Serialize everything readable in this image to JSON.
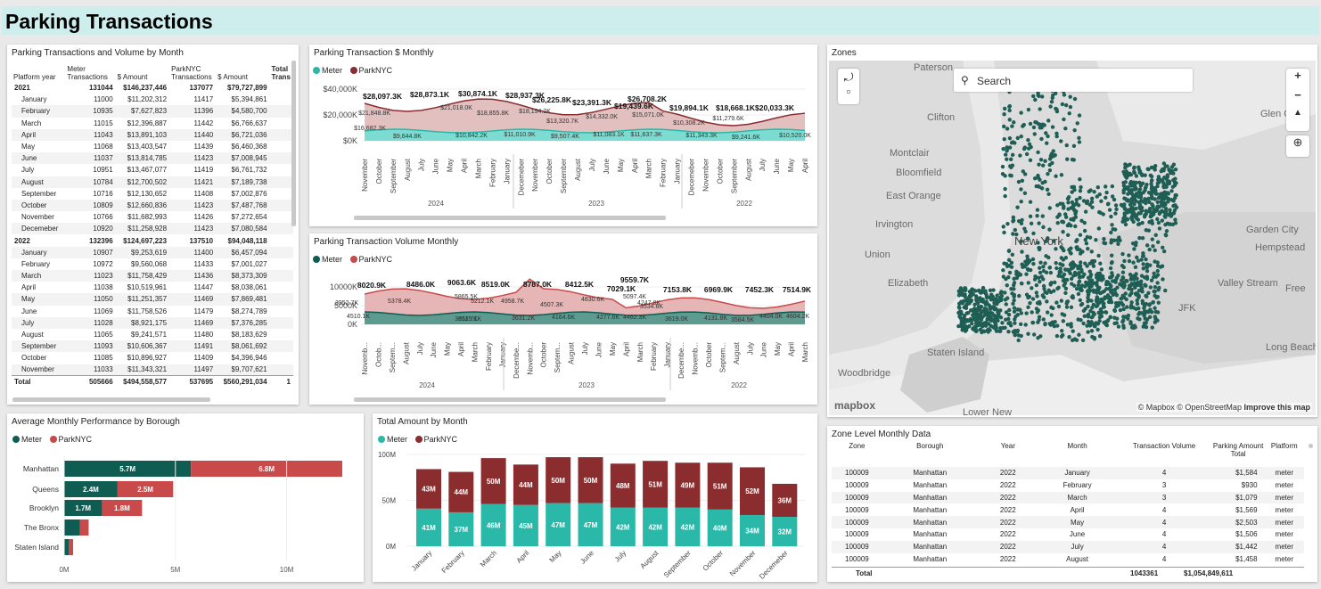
{
  "page": {
    "title": "Parking Transactions"
  },
  "colors": {
    "meter": "#2ab9a8",
    "parknyc": "#8b2c2e",
    "meter_dark": "#0f5d52",
    "parknyc_light": "#c94a4a"
  },
  "matrix": {
    "title": "Parking Transactions and Volume by Month",
    "headers": {
      "year": "Platform year",
      "meter_tx": "Meter Transactions",
      "meter_amt": "$ Amount",
      "park_tx": "ParkNYC Transactions",
      "park_amt": "$ Amount",
      "total": "Total Trans"
    },
    "rows": [
      {
        "k": "yr",
        "c": [
          "2021",
          "131044",
          "$146,237,446",
          "137077",
          "$79,727,899",
          ""
        ]
      },
      {
        "k": "mo",
        "c": [
          "January",
          "11000",
          "$11,202,312",
          "11417",
          "$5,394,861",
          ""
        ]
      },
      {
        "k": "mo",
        "c": [
          "February",
          "10935",
          "$7,627,823",
          "11396",
          "$4,580,700",
          ""
        ]
      },
      {
        "k": "mo",
        "c": [
          "March",
          "11015",
          "$12,396,887",
          "11442",
          "$6,766,637",
          ""
        ]
      },
      {
        "k": "mo",
        "c": [
          "April",
          "11043",
          "$13,891,103",
          "11440",
          "$6,721,036",
          ""
        ]
      },
      {
        "k": "mo",
        "c": [
          "May",
          "11068",
          "$13,403,547",
          "11439",
          "$6,460,368",
          ""
        ]
      },
      {
        "k": "mo",
        "c": [
          "June",
          "11037",
          "$13,814,785",
          "11423",
          "$7,008,945",
          ""
        ]
      },
      {
        "k": "mo",
        "c": [
          "July",
          "10951",
          "$13,467,077",
          "11419",
          "$6,761,732",
          ""
        ]
      },
      {
        "k": "mo",
        "c": [
          "August",
          "10784",
          "$12,700,502",
          "11421",
          "$7,189,738",
          ""
        ]
      },
      {
        "k": "mo",
        "c": [
          "September",
          "10716",
          "$12,130,652",
          "11408",
          "$7,002,876",
          ""
        ]
      },
      {
        "k": "mo",
        "c": [
          "October",
          "10809",
          "$12,660,836",
          "11423",
          "$7,487,768",
          ""
        ]
      },
      {
        "k": "mo",
        "c": [
          "November",
          "10766",
          "$11,682,993",
          "11426",
          "$7,272,654",
          ""
        ]
      },
      {
        "k": "mo",
        "c": [
          "Decemeber",
          "10920",
          "$11,258,928",
          "11423",
          "$7,080,584",
          ""
        ]
      },
      {
        "k": "yr",
        "c": [
          "2022",
          "132396",
          "$124,697,223",
          "137510",
          "$94,048,118",
          ""
        ]
      },
      {
        "k": "mo",
        "c": [
          "January",
          "10907",
          "$9,253,619",
          "11400",
          "$6,457,094",
          ""
        ]
      },
      {
        "k": "mo",
        "c": [
          "February",
          "10972",
          "$9,560,068",
          "11433",
          "$7,001,027",
          ""
        ]
      },
      {
        "k": "mo",
        "c": [
          "March",
          "11023",
          "$11,758,429",
          "11436",
          "$8,373,309",
          ""
        ]
      },
      {
        "k": "mo",
        "c": [
          "April",
          "11038",
          "$10,519,961",
          "11447",
          "$8,038,061",
          ""
        ]
      },
      {
        "k": "mo",
        "c": [
          "May",
          "11050",
          "$11,251,357",
          "11469",
          "$7,869,481",
          ""
        ]
      },
      {
        "k": "mo",
        "c": [
          "June",
          "11069",
          "$11,758,526",
          "11479",
          "$8,274,789",
          ""
        ]
      },
      {
        "k": "mo",
        "c": [
          "July",
          "11028",
          "$8,921,175",
          "11469",
          "$7,376,285",
          ""
        ]
      },
      {
        "k": "mo",
        "c": [
          "August",
          "11065",
          "$9,241,571",
          "11480",
          "$8,183,629",
          ""
        ]
      },
      {
        "k": "mo",
        "c": [
          "September",
          "11093",
          "$10,606,367",
          "11491",
          "$8,061,692",
          ""
        ]
      },
      {
        "k": "mo",
        "c": [
          "October",
          "11085",
          "$10,896,927",
          "11409",
          "$4,396,946",
          ""
        ]
      },
      {
        "k": "mo",
        "c": [
          "November",
          "11033",
          "$11,343,321",
          "11497",
          "$9,707,621",
          ""
        ]
      },
      {
        "k": "tot",
        "c": [
          "Total",
          "505666",
          "$494,558,577",
          "537695",
          "$560,291,034",
          "1"
        ]
      }
    ]
  },
  "amount_chart": {
    "title": "Parking Transaction $ Monthly",
    "legend": [
      "Meter",
      "ParkNYC"
    ],
    "y_ticks": [
      "$40,000K",
      "$20,000K",
      "$0K"
    ],
    "months": [
      "November",
      "October",
      "September",
      "August",
      "July",
      "June",
      "May",
      "April",
      "March",
      "February",
      "January",
      "Decemeber",
      "November",
      "October",
      "September",
      "August",
      "July",
      "June",
      "May",
      "April",
      "March",
      "February",
      "January",
      "Decemeber",
      "November",
      "October",
      "September",
      "August",
      "July",
      "June",
      "May",
      "April"
    ],
    "years": [
      "2024",
      "2023",
      "2022"
    ],
    "top_labels": [
      "$28,097.3K",
      "$28,873.1K",
      "$30,874.1K",
      "$28,937.3K",
      "$26,225.8K",
      "$23,391.3K",
      "$26,708.2K",
      "$19,439.6K",
      "$19,894.1K",
      "$18,668.1K",
      "$20,033.3K"
    ],
    "park_labels": [
      "$16,682.3K",
      "$21,848.8K",
      "$21,018.0K",
      "$18,855.8K",
      "$18,194.2K",
      "$13,320.7K",
      "$14,332.0K",
      "$15,071.0K",
      "$10,308.2K",
      "$11,279.6K"
    ],
    "meter_labels": [
      "$9,644.8K",
      "$10,842.2K",
      "$11,010.9K",
      "$9,507.4K",
      "$11,083.1K",
      "$11,637.3K",
      "$11,343.3K",
      "$9,241.6K",
      "$10,520.0K"
    ]
  },
  "volume_chart": {
    "title": "Parking Transaction Volume Monthly",
    "legend": [
      "Meter",
      "ParkNYC"
    ],
    "y_ticks": [
      "10000K",
      "5000K",
      "0K"
    ],
    "months": [
      "Novemb...",
      "Octob...",
      "Septem...",
      "August",
      "July",
      "June",
      "May",
      "April",
      "March",
      "February",
      "January",
      "Decembe...",
      "Novemb...",
      "October",
      "Septem...",
      "August",
      "July",
      "June",
      "May",
      "April",
      "March",
      "February",
      "January",
      "Decembe...",
      "Novemb...",
      "October",
      "Septem...",
      "August",
      "July",
      "June",
      "May",
      "April",
      "March"
    ],
    "years": [
      "2024",
      "2023",
      "2022"
    ],
    "top_labels": [
      "8020.9K",
      "8486.0K",
      "9063.6K",
      "8519.0K",
      "8787.0K",
      "8412.5K",
      "9559.7K",
      "7029.1K",
      "7153.8K",
      "6969.9K",
      "7452.3K",
      "7514.9K"
    ],
    "park_labels": [
      "3952.7K",
      "5378.4K",
      "5865.5K",
      "5212.1K",
      "4958.7K",
      "4507.3K",
      "4830.6K",
      "5097.4K",
      "4247.8K",
      "3534.8K"
    ],
    "meter_labels": [
      "4510.1K",
      "3611.7K",
      "3535.1K",
      "3631.2K",
      "4164.6K",
      "4277.6K",
      "4462.3K",
      "3619.0K",
      "4131.8K",
      "3584.5K",
      "4404.0K",
      "4604.2K"
    ]
  },
  "borough_chart": {
    "title": "Average Monthly Performance by Borough",
    "legend": [
      "Meter",
      "ParkNYC"
    ],
    "categories": [
      "Manhattan",
      "Queens",
      "Brooklyn",
      "The Bronx",
      "Staten Island"
    ],
    "meter": [
      5.7,
      2.4,
      1.7,
      0.7,
      0.2
    ],
    "park": [
      6.8,
      2.5,
      1.8,
      0.4,
      0.2
    ],
    "meter_labels": [
      "5.7M",
      "2.4M",
      "1.7M",
      "",
      ""
    ],
    "park_labels": [
      "6.8M",
      "2.5M",
      "1.8M",
      "",
      ""
    ],
    "x_ticks": [
      "0M",
      "5M",
      "10M"
    ],
    "xlim": [
      0,
      11.5
    ]
  },
  "total_chart": {
    "title": "Total Amount by Month",
    "legend": [
      "Meter",
      "ParkNYC"
    ],
    "categories": [
      "January",
      "February",
      "March",
      "April",
      "May",
      "June",
      "July",
      "August",
      "September",
      "October",
      "November",
      "Decemeber"
    ],
    "meter": [
      41,
      37,
      46,
      45,
      47,
      47,
      42,
      42,
      42,
      40,
      34,
      32
    ],
    "park": [
      43,
      44,
      50,
      44,
      50,
      50,
      48,
      51,
      49,
      51,
      52,
      36
    ],
    "meter_labels": [
      "41M",
      "37M",
      "46M",
      "45M",
      "47M",
      "47M",
      "42M",
      "42M",
      "42M",
      "40M",
      "34M",
      "32M"
    ],
    "park_labels": [
      "43M",
      "44M",
      "50M",
      "44M",
      "50M",
      "50M",
      "48M",
      "51M",
      "49M",
      "51M",
      "52M",
      "36M"
    ],
    "y_ticks": [
      "100M",
      "50M",
      "0M"
    ],
    "ylim": [
      0,
      100
    ]
  },
  "zones": {
    "title": "Zones",
    "search_placeholder": "Search",
    "labels": [
      "Paterson",
      "Clifton",
      "Montclair",
      "Bloomfield",
      "East Orange",
      "Irvington",
      "Union",
      "Elizabeth",
      "New York",
      "Staten Island",
      "Woodbridge",
      "Glen C",
      "Garden City",
      "Hempstead",
      "Valley Stream",
      "Free",
      "JFK",
      "Long Beach",
      "Lower New"
    ],
    "attribution": "© Mapbox © OpenStreetMap",
    "improve": "Improve this map",
    "logo": "mapbox"
  },
  "zone_table": {
    "title": "Zone Level Monthly Data",
    "headers": [
      "Zone",
      "Borough",
      "Year",
      "Month",
      "Transaction Volume",
      "Parking Amount Total",
      "Platform"
    ],
    "rows": [
      [
        "100009",
        "Manhattan",
        "2022",
        "January",
        "4",
        "$1,584",
        "meter"
      ],
      [
        "100009",
        "Manhattan",
        "2022",
        "February",
        "3",
        "$930",
        "meter"
      ],
      [
        "100009",
        "Manhattan",
        "2022",
        "March",
        "3",
        "$1,079",
        "meter"
      ],
      [
        "100009",
        "Manhattan",
        "2022",
        "April",
        "4",
        "$1,569",
        "meter"
      ],
      [
        "100009",
        "Manhattan",
        "2022",
        "May",
        "4",
        "$2,503",
        "meter"
      ],
      [
        "100009",
        "Manhattan",
        "2022",
        "June",
        "4",
        "$1,506",
        "meter"
      ],
      [
        "100009",
        "Manhattan",
        "2022",
        "July",
        "4",
        "$1,442",
        "meter"
      ],
      [
        "100009",
        "Manhattan",
        "2022",
        "August",
        "4",
        "$1,458",
        "meter"
      ]
    ],
    "total": [
      "Total",
      "",
      "",
      "",
      "1043361",
      "$1,054,849,611",
      ""
    ]
  }
}
